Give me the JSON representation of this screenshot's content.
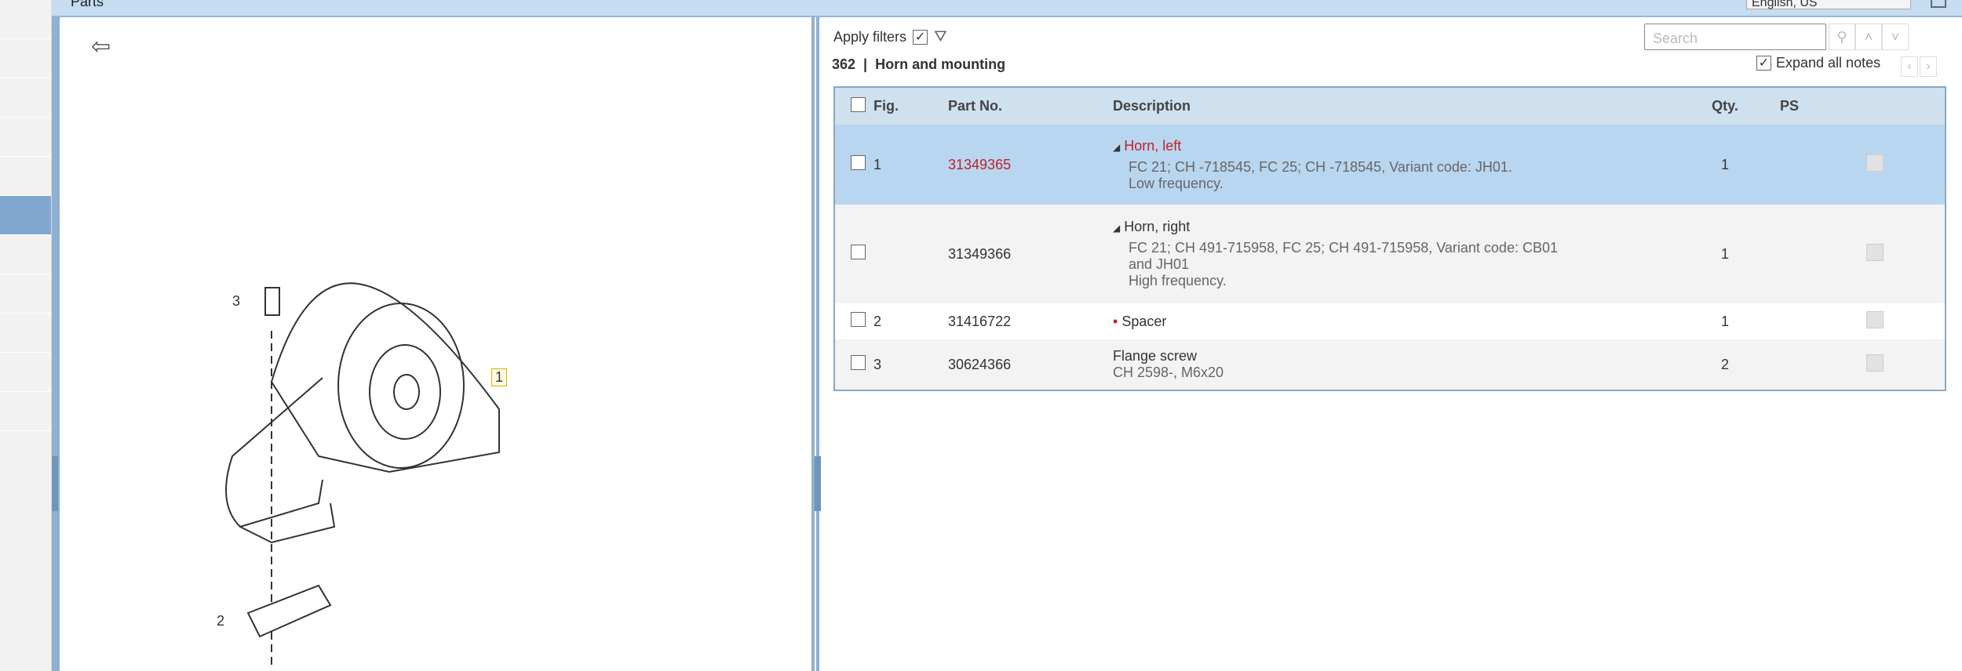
{
  "header": {
    "title": "Parts",
    "language": "English, US"
  },
  "filters": {
    "apply_label": "Apply filters",
    "apply_checked": true
  },
  "group": {
    "number": "362",
    "name": "Horn and mounting"
  },
  "search": {
    "placeholder": "Search"
  },
  "expand_notes": {
    "label": "Expand all notes",
    "checked": true
  },
  "table": {
    "headers": {
      "fig": "Fig.",
      "part_no": "Part No.",
      "description": "Description",
      "qty": "Qty.",
      "ps": "PS"
    },
    "rows": [
      {
        "fig": "1",
        "part_no": "31349365",
        "name": "Horn, left",
        "details": "FC 21; CH -718545, FC 25; CH -718545, Variant code: JH01.",
        "extra": "Low frequency.",
        "qty": "1"
      },
      {
        "fig": "",
        "part_no": "31349366",
        "name": "Horn, right",
        "details": "FC 21; CH 491-715958, FC 25; CH 491-715958, Variant code: CB01 and JH01",
        "extra": "High frequency.",
        "qty": "1"
      },
      {
        "fig": "2",
        "part_no": "31416722",
        "name": "Spacer",
        "qty": "1"
      },
      {
        "fig": "3",
        "part_no": "30624366",
        "name": "Flange screw",
        "details": "CH 2598-, M6x20",
        "qty": "2"
      }
    ]
  },
  "illustration": {
    "callouts": [
      "1",
      "2",
      "3"
    ]
  }
}
